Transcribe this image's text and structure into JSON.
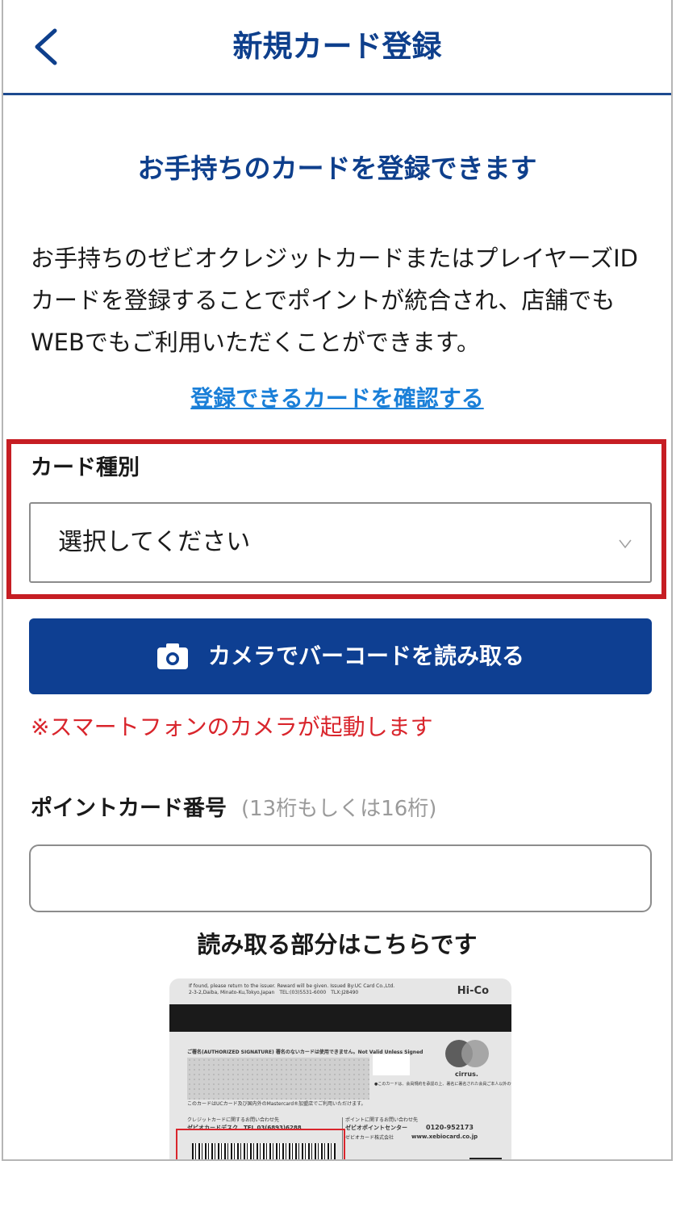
{
  "header": {
    "title": "新規カード登録"
  },
  "intro": {
    "subtitle": "お手持ちのカードを登録できます",
    "description": "お手持ちのゼビオクレジットカードまたはプレイヤーズIDカードを登録することでポイントが統合され、店舗でもWEBでもご利用いただくことができます。",
    "link_label": "登録できるカードを確認する"
  },
  "card_type": {
    "label": "カード種別",
    "selected": "選択してください"
  },
  "camera_button": {
    "label": "カメラでバーコードを読み取る"
  },
  "camera_notice": "※スマートフォンのカメラが起動します",
  "point_card": {
    "label": "ポイントカード番号",
    "hint": "(13桁もしくは16桁)",
    "value": ""
  },
  "read_area_heading": "読み取る部分はこちらです",
  "card_image": {
    "issuer_text": "If found, please return to the issuer. Reward will be given. Issued By:UC Card Co.,Ltd.",
    "issuer_address": "2-3-2,Daiba, Minato-Ku,Tokyo,Japan　TEL:(03)5531-6000　TLX:J28490",
    "hico": "Hi-Co",
    "signature_label": "ご署名(AUTHORIZED SIGNATURE) 署名のないカードは使用できません。Not Valid Unless Signed",
    "cirrus": "cirrus.",
    "notes": "●このカードは、会員規約を承認の上、署名に署名された会員ご本人以外の使用はできません。",
    "usage": "このカードはUCカード及び国内外のMastercard®加盟店でご利用いただけます。",
    "credit_inquiry": "クレジットカードに関するお問い合わせ先",
    "desk": "ゼビオカードデスク　TEL 03(6893)6288",
    "point_inquiry": "ポイントに関するお問い合わせ先",
    "point_center": "ゼビオポイントセンター",
    "freecall": "0120-952173",
    "company": "ゼビオカード株式会社",
    "website": "www.xebiocard.co.jp"
  },
  "colors": {
    "primary": "#0e3f92",
    "link": "#1a7fd8",
    "highlight": "#c61d23",
    "notice": "#d9252c"
  }
}
